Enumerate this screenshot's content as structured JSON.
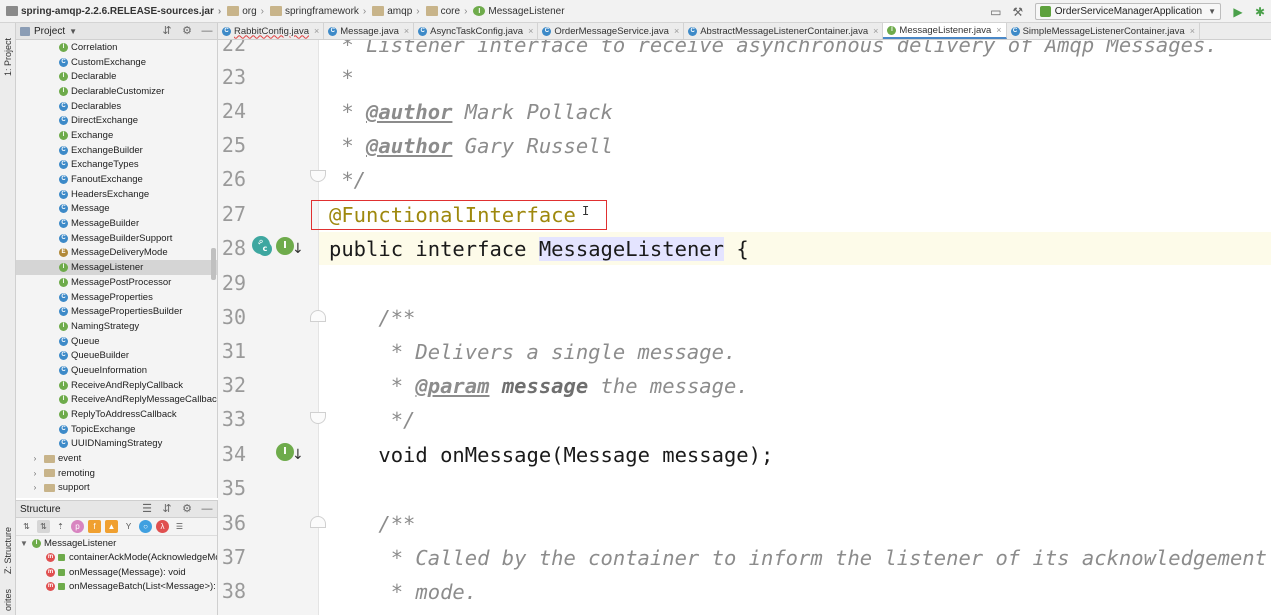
{
  "navbar": {
    "breadcrumbs": [
      {
        "label": "spring-amqp-2.2.6.RELEASE-sources.jar",
        "icon": "jar-icon"
      },
      {
        "label": "org",
        "icon": "folder-icon"
      },
      {
        "label": "springframework",
        "icon": "folder-icon"
      },
      {
        "label": "amqp",
        "icon": "folder-icon"
      },
      {
        "label": "core",
        "icon": "folder-icon"
      },
      {
        "label": "MessageListener",
        "icon": "interface-icon"
      }
    ],
    "run_config": "OrderServiceManagerApplication"
  },
  "tool_stripe": {
    "project": "1: Project",
    "structure": "Z: Structure",
    "favorites": "orites"
  },
  "project_panel": {
    "title": "Project",
    "items": [
      {
        "label": "Correlation",
        "kind": "iface"
      },
      {
        "label": "CustomExchange",
        "kind": "class"
      },
      {
        "label": "Declarable",
        "kind": "iface"
      },
      {
        "label": "DeclarableCustomizer",
        "kind": "iface"
      },
      {
        "label": "Declarables",
        "kind": "class"
      },
      {
        "label": "DirectExchange",
        "kind": "class"
      },
      {
        "label": "Exchange",
        "kind": "iface"
      },
      {
        "label": "ExchangeBuilder",
        "kind": "class"
      },
      {
        "label": "ExchangeTypes",
        "kind": "class"
      },
      {
        "label": "FanoutExchange",
        "kind": "class"
      },
      {
        "label": "HeadersExchange",
        "kind": "class"
      },
      {
        "label": "Message",
        "kind": "class"
      },
      {
        "label": "MessageBuilder",
        "kind": "class"
      },
      {
        "label": "MessageBuilderSupport",
        "kind": "class"
      },
      {
        "label": "MessageDeliveryMode",
        "kind": "enum"
      },
      {
        "label": "MessageListener",
        "kind": "iface",
        "selected": true
      },
      {
        "label": "MessagePostProcessor",
        "kind": "iface"
      },
      {
        "label": "MessageProperties",
        "kind": "class"
      },
      {
        "label": "MessagePropertiesBuilder",
        "kind": "class"
      },
      {
        "label": "NamingStrategy",
        "kind": "iface"
      },
      {
        "label": "Queue",
        "kind": "class"
      },
      {
        "label": "QueueBuilder",
        "kind": "class"
      },
      {
        "label": "QueueInformation",
        "kind": "class"
      },
      {
        "label": "ReceiveAndReplyCallback",
        "kind": "iface"
      },
      {
        "label": "ReceiveAndReplyMessageCallback",
        "kind": "iface"
      },
      {
        "label": "ReplyToAddressCallback",
        "kind": "iface"
      },
      {
        "label": "TopicExchange",
        "kind": "class"
      },
      {
        "label": "UUIDNamingStrategy",
        "kind": "class"
      }
    ],
    "folders": [
      {
        "label": "event"
      },
      {
        "label": "remoting"
      },
      {
        "label": "support"
      }
    ]
  },
  "structure_panel": {
    "title": "Structure",
    "root": "MessageListener",
    "methods": [
      {
        "label": "containerAckMode(AcknowledgeMo"
      },
      {
        "label": "onMessage(Message): void"
      },
      {
        "label": "onMessageBatch(List<Message>): v"
      }
    ]
  },
  "editor_tabs": [
    {
      "label": "RabbitConfig.java",
      "kind": "class",
      "error": true
    },
    {
      "label": "Message.java",
      "kind": "class"
    },
    {
      "label": "AsyncTaskConfig.java",
      "kind": "class"
    },
    {
      "label": "OrderMessageService.java",
      "kind": "class"
    },
    {
      "label": "AbstractMessageListenerContainer.java",
      "kind": "class"
    },
    {
      "label": "MessageListener.java",
      "kind": "iface",
      "active": true
    },
    {
      "label": "SimpleMessageListenerContainer.java",
      "kind": "class"
    }
  ],
  "editor": {
    "line_numbers": [
      "22",
      "23",
      "24",
      "25",
      "26",
      "27",
      "28",
      "29",
      "30",
      "31",
      "32",
      "33",
      "34",
      "35",
      "36",
      "37",
      "38"
    ],
    "lines": {
      "l22": " * Listener interface to receive asynchronous delivery of Amqp Messages.",
      "l23": " *",
      "l24_pre": " * ",
      "l24_tag": "@author",
      "l24_post": " Mark Pollack",
      "l25_pre": " * ",
      "l25_tag": "@author",
      "l25_post": " Gary Russell",
      "l26": " */",
      "l27": "@FunctionalInterface",
      "l28_kw1": "public",
      "l28_kw2": "interface",
      "l28_name": "MessageListener",
      "l28_post": " {",
      "l30": "    /**",
      "l31": "     * Delivers a single message.",
      "l32_pre": "     * ",
      "l32_tag": "@param",
      "l32_pname": "message",
      "l32_post": " the message.",
      "l33": "     */",
      "l34_kw": "    void",
      "l34_post": " onMessage(Message message);",
      "l36": "    /**",
      "l37": "     * Called by the container to inform the listener of its acknowledgement",
      "l38": "     * mode."
    }
  },
  "colors": {
    "keyword": "#0033b3",
    "annotation": "#9e880d",
    "comment": "#8c8c8c",
    "highlight_box": "#e03030"
  }
}
